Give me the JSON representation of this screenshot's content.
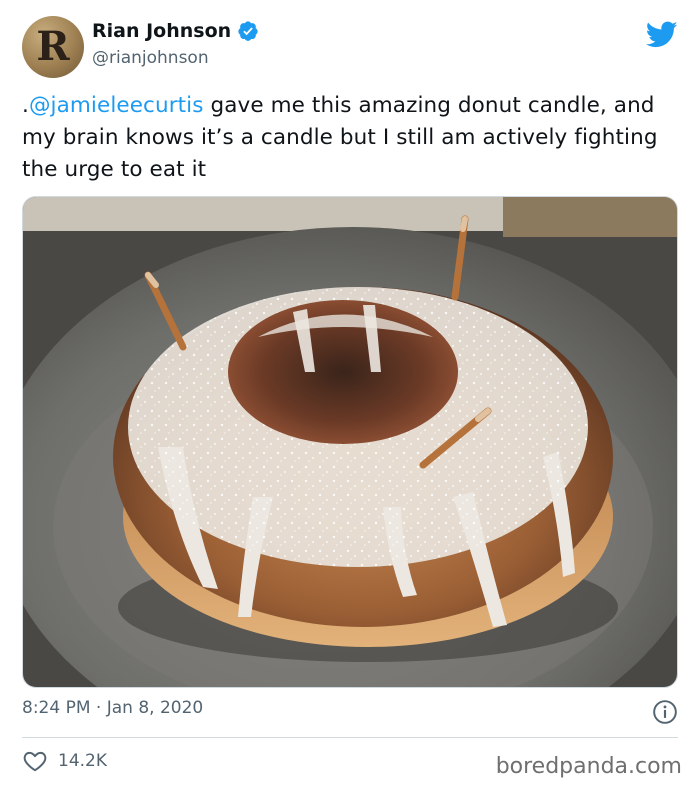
{
  "author": {
    "name": "Rian Johnson",
    "handle": "@rianjohnson",
    "avatar_letter": "R",
    "verified_icon": "verified-badge-icon"
  },
  "tweet": {
    "prefix": ".",
    "mention": "@jamieleecurtis",
    "body": " gave me this amazing donut candle, and my brain knows it’s a candle but I still am actively fighting the urge to eat it"
  },
  "meta": {
    "time": "8:24 PM",
    "separator": " · ",
    "date": "Jan 8, 2020"
  },
  "engagement": {
    "likes": "14.2K"
  },
  "watermark": "boredpanda.com",
  "colors": {
    "accent": "#1d9bf0",
    "secondary_text": "#536471",
    "divider": "#cfd9de"
  }
}
